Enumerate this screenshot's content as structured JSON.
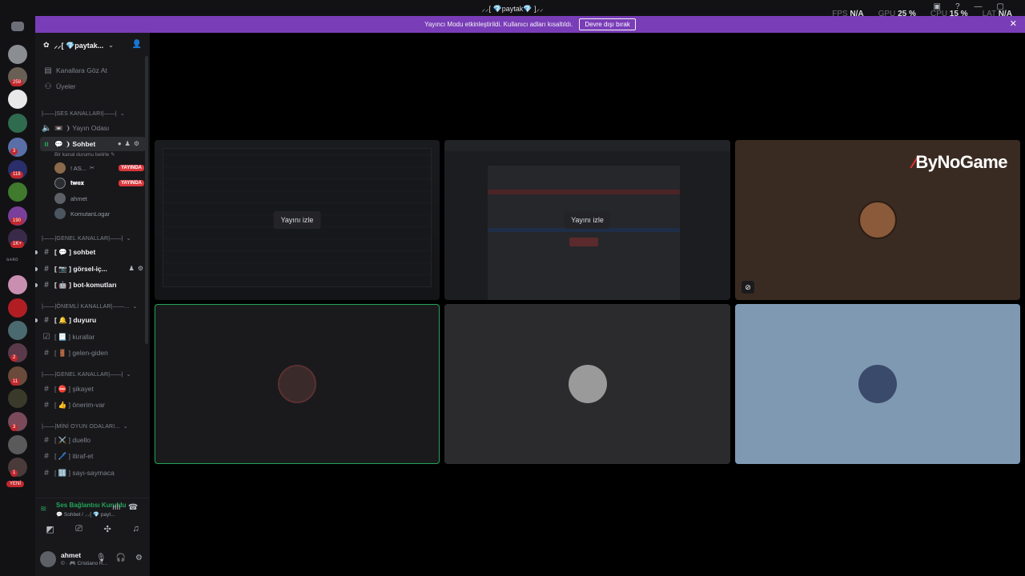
{
  "titlebar": {
    "title": "⸝⸝[ 💎paytak💎 ]⸝⸝",
    "stats": [
      {
        "label": "FPS",
        "value": "N/A"
      },
      {
        "label": "GPU",
        "value": "25 %"
      },
      {
        "label": "CPU",
        "value": "15 %"
      },
      {
        "label": "LAT",
        "value": "N/A"
      }
    ]
  },
  "banner": {
    "text": "Yayıncı Modu etkinleştirildi. Kullanıcı adları kısaltıldı.",
    "button": "Devre dışı bırak"
  },
  "rail": {
    "badges": [
      "259",
      "3",
      "118",
      "190",
      "1K+",
      "2",
      "11",
      "3",
      "1"
    ],
    "new_label": "YENİ",
    "text_logo": "ɢᴀʀᴅ"
  },
  "guild": {
    "name": "⸝⸝[ 💎paytak..."
  },
  "top_links": [
    {
      "label": "Kanallara Göz At"
    },
    {
      "label": "Üyeler"
    }
  ],
  "categories": [
    {
      "label": "|——|SES KANALLARI|——|"
    },
    {
      "label": "|——|GENEL KANALLAR|——|"
    },
    {
      "label": "|——|ÖNEMLİ KANALLAR|——..."
    },
    {
      "label": "|——|GENEL KANALLAR|——|"
    },
    {
      "label": "|——|MİNİ OYUN ODALARI..."
    }
  ],
  "voice_channels": [
    {
      "label": "📼 ❩ Yayın Odası"
    },
    {
      "label": "💬 ❩ Sohbet",
      "status": "Bir kanal durumu belirle ✎"
    }
  ],
  "voice_users": [
    {
      "name": "! AS...",
      "live": "YAYINDA"
    },
    {
      "name": "𝐭𝐰𝐞𝐱",
      "live": "YAYINDA"
    },
    {
      "name": "ahmet"
    },
    {
      "name": "KomutanLogar"
    }
  ],
  "text_channels": [
    {
      "label": "[ 💬 ] sohbet"
    },
    {
      "label": "[ 📷 ] görsel-iç..."
    },
    {
      "label": "[ 🤖 ] bot-komutları"
    },
    {
      "label": "[ 🔔 ] duyuru"
    },
    {
      "label": "[ 📃 ] kurallar"
    },
    {
      "label": "[ 🚪 ] gelen-giden"
    },
    {
      "label": "[ ⛔ ] şikayet"
    },
    {
      "label": "[ 👍 ] önerim-var"
    },
    {
      "label": "[ ⚔️ ] duello"
    },
    {
      "label": "[ 🖊️ ] itiraf-et"
    },
    {
      "label": "[ 🔢 ] sayı-saymaca"
    }
  ],
  "voice_panel": {
    "status": "Ses Bağlantısı Kuruldu",
    "sub": "💬 Sohbet / ⸝⸝[ 💎 payt..."
  },
  "user_panel": {
    "name": "ahmet",
    "status": "© · 🎮 Cristiano R..."
  },
  "stage": {
    "watch_label": "Yayını izle",
    "brand_logo_text": "ByNoGame"
  }
}
